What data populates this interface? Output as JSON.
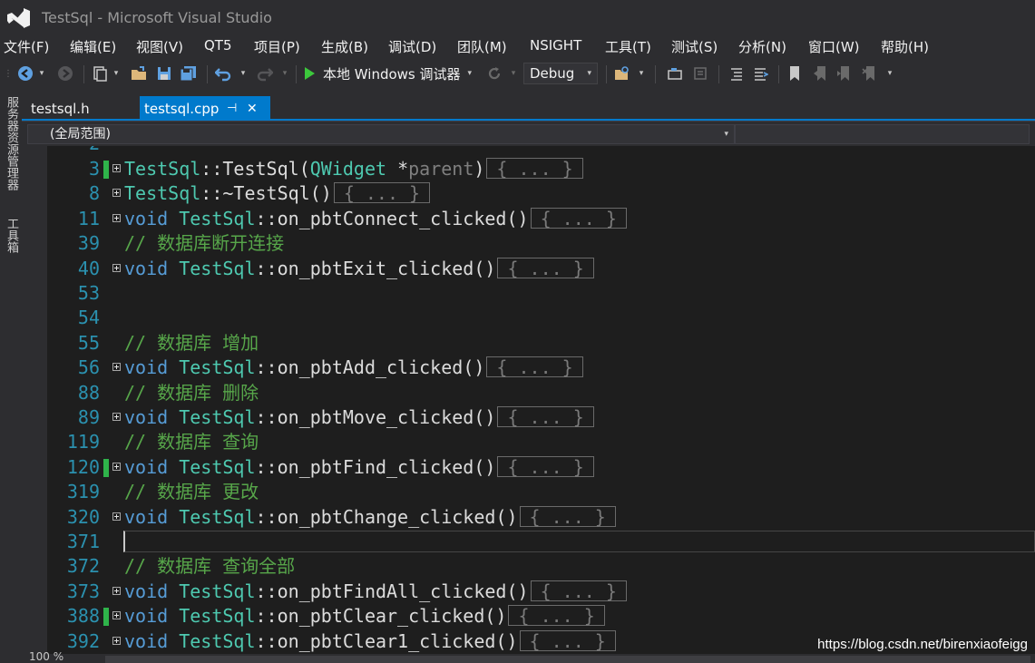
{
  "window": {
    "title": "TestSql - Microsoft Visual Studio"
  },
  "menu": [
    "文件(F)",
    "编辑(E)",
    "视图(V)",
    "QT5",
    "项目(P)",
    "生成(B)",
    "调试(D)",
    "团队(M)",
    "NSIGHT",
    "工具(T)",
    "测试(S)",
    "分析(N)",
    "窗口(W)",
    "帮助(H)"
  ],
  "toolbar": {
    "run_label": "本地 Windows 调试器",
    "config": "Debug"
  },
  "side_panels": [
    "服务器资源管理器",
    "工具箱"
  ],
  "tabs": [
    {
      "label": "testsql.h",
      "active": false
    },
    {
      "label": "testsql.cpp",
      "active": true,
      "pin": "⊣",
      "close": "✕"
    }
  ],
  "nav": {
    "scope": "(全局范围)"
  },
  "code": {
    "collapsed_marker": "{ ... }",
    "lines": [
      {
        "num": "3",
        "fold": true,
        "changed": true,
        "kind": "ctor",
        "cls": "TestSql",
        "sep": "::",
        "name": "TestSql",
        "open": "(",
        "ptype": "QWidget",
        "pstar": " *",
        "pname": "parent",
        "close": ")"
      },
      {
        "num": "8",
        "fold": true,
        "changed": false,
        "kind": "dtor",
        "cls": "TestSql",
        "sep": "::",
        "name": "~TestSql",
        "open": "(",
        "close": ")"
      },
      {
        "num": "11",
        "fold": true,
        "changed": false,
        "kind": "func",
        "ret": "void",
        "cls": "TestSql",
        "sep": "::",
        "name": "on_pbtConnect_clicked",
        "parens": "()"
      },
      {
        "num": "39",
        "fold": false,
        "changed": false,
        "kind": "comment",
        "text": "// 数据库断开连接"
      },
      {
        "num": "40",
        "fold": true,
        "changed": false,
        "kind": "func",
        "ret": "void",
        "cls": "TestSql",
        "sep": "::",
        "name": "on_pbtExit_clicked",
        "parens": "()"
      },
      {
        "num": "53",
        "fold": false,
        "changed": false,
        "kind": "blank"
      },
      {
        "num": "54",
        "fold": false,
        "changed": false,
        "kind": "blank"
      },
      {
        "num": "55",
        "fold": false,
        "changed": false,
        "kind": "comment",
        "text": "// 数据库 增加"
      },
      {
        "num": "56",
        "fold": true,
        "changed": false,
        "kind": "func",
        "ret": "void",
        "cls": "TestSql",
        "sep": "::",
        "name": "on_pbtAdd_clicked",
        "parens": "()"
      },
      {
        "num": "88",
        "fold": false,
        "changed": false,
        "kind": "comment",
        "text": "// 数据库 删除"
      },
      {
        "num": "89",
        "fold": true,
        "changed": false,
        "kind": "func",
        "ret": "void",
        "cls": "TestSql",
        "sep": "::",
        "name": "on_pbtMove_clicked",
        "parens": "()"
      },
      {
        "num": "119",
        "fold": false,
        "changed": false,
        "kind": "comment",
        "text": "// 数据库 查询"
      },
      {
        "num": "120",
        "fold": true,
        "changed": true,
        "kind": "func",
        "ret": "void",
        "cls": "TestSql",
        "sep": "::",
        "name": "on_pbtFind_clicked",
        "parens": "()"
      },
      {
        "num": "319",
        "fold": false,
        "changed": false,
        "kind": "comment",
        "text": "// 数据库 更改"
      },
      {
        "num": "320",
        "fold": true,
        "changed": false,
        "kind": "func",
        "ret": "void",
        "cls": "TestSql",
        "sep": "::",
        "name": "on_pbtChange_clicked",
        "parens": "()"
      },
      {
        "num": "371",
        "fold": false,
        "changed": false,
        "kind": "blank"
      },
      {
        "num": "372",
        "fold": false,
        "changed": false,
        "kind": "comment",
        "text": "// 数据库 查询全部"
      },
      {
        "num": "373",
        "fold": true,
        "changed": false,
        "kind": "func",
        "ret": "void",
        "cls": "TestSql",
        "sep": "::",
        "name": "on_pbtFindAll_clicked",
        "parens": "()"
      },
      {
        "num": "388",
        "fold": true,
        "changed": true,
        "kind": "func",
        "ret": "void",
        "cls": "TestSql",
        "sep": "::",
        "name": "on_pbtClear_clicked",
        "parens": "()"
      },
      {
        "num": "392",
        "fold": true,
        "changed": false,
        "kind": "func",
        "ret": "void",
        "cls": "TestSql",
        "sep": "::",
        "name": "on_pbtClear1_clicked",
        "parens": "()"
      }
    ]
  },
  "status": {
    "zoom": "100 %"
  },
  "watermark": "https://blog.csdn.net/birenxiaofeigg",
  "colors": {
    "accent": "#007acc",
    "keyword": "#569cd6",
    "type": "#4ec9b0",
    "comment": "#57a64a",
    "line_number": "#2b91af",
    "changed_bar": "#2fb34a"
  }
}
